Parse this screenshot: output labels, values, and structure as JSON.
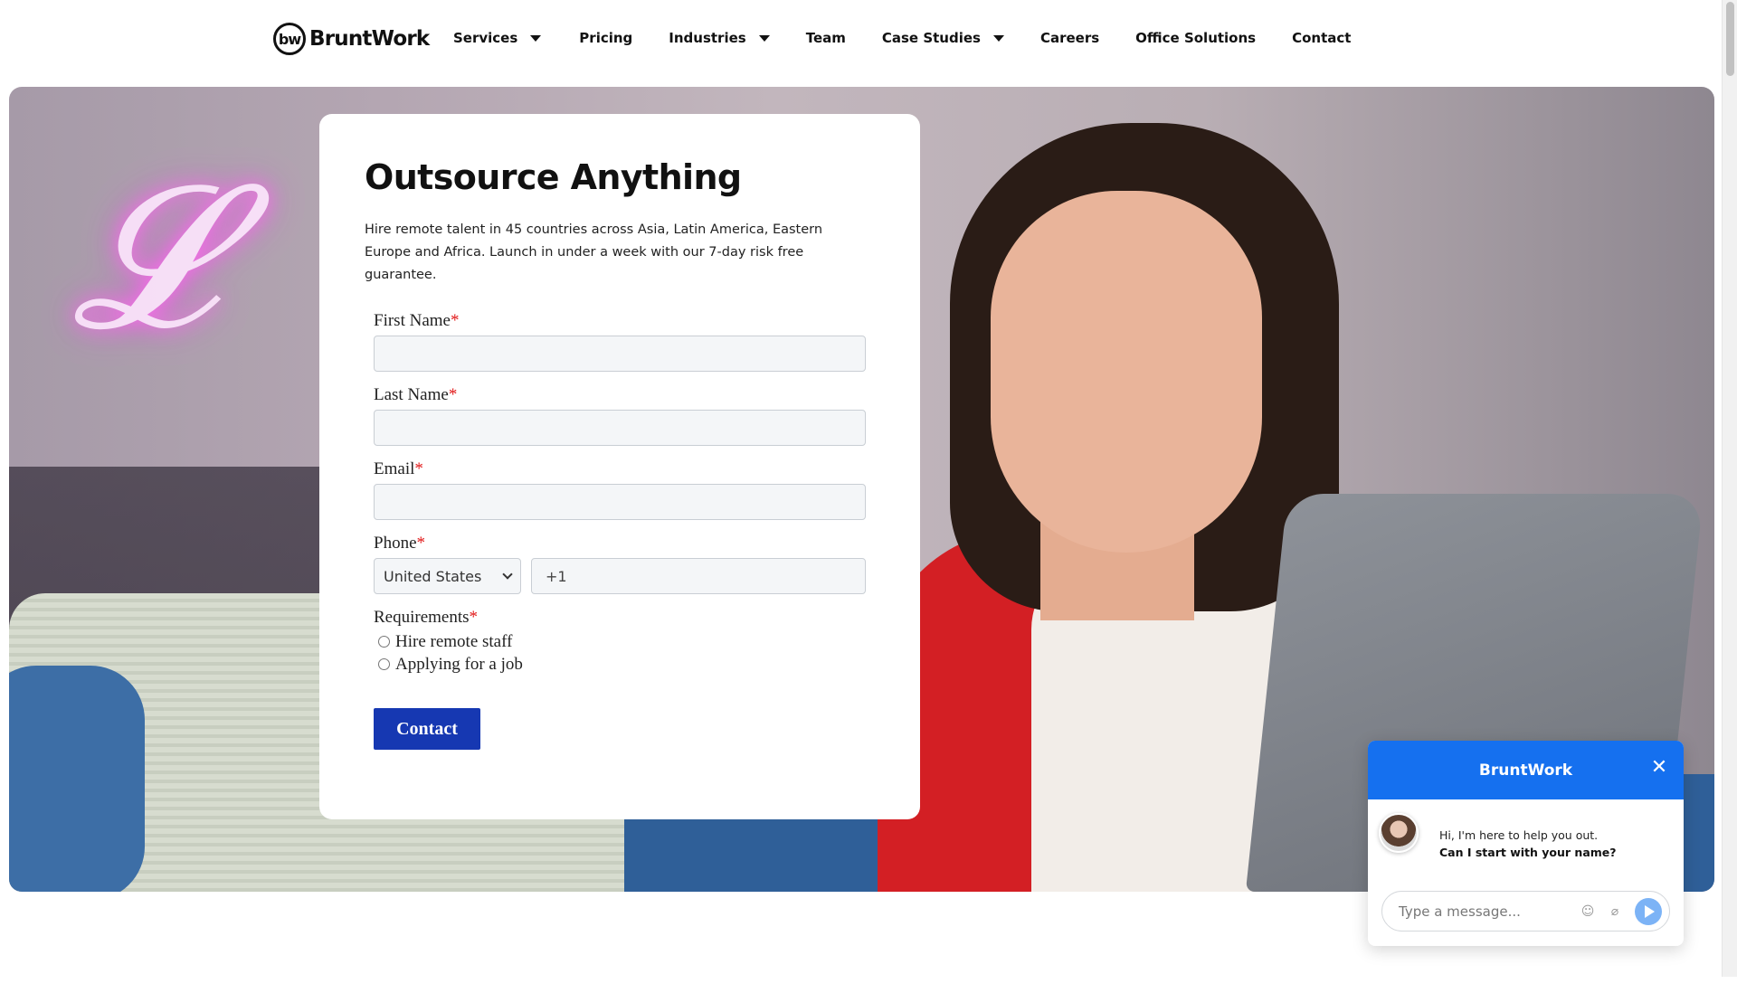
{
  "brand": {
    "logo_mark": "bw",
    "name": "BruntWork"
  },
  "nav": {
    "items": [
      {
        "label": "Services",
        "has_dropdown": true
      },
      {
        "label": "Pricing",
        "has_dropdown": false
      },
      {
        "label": "Industries",
        "has_dropdown": true
      },
      {
        "label": "Team",
        "has_dropdown": false
      },
      {
        "label": "Case Studies",
        "has_dropdown": true
      },
      {
        "label": "Careers",
        "has_dropdown": false
      },
      {
        "label": "Office Solutions",
        "has_dropdown": false
      },
      {
        "label": "Contact",
        "has_dropdown": false
      }
    ]
  },
  "hero": {
    "title": "Outsource Anything",
    "description": "Hire remote talent in 45 countries across Asia, Latin America, Eastern Europe and Africa. Launch in under a week with our 7-day risk free guarantee."
  },
  "form": {
    "first_name_label": "First Name",
    "last_name_label": "Last Name",
    "email_label": "Email",
    "phone_label": "Phone",
    "requirements_label": "Requirements",
    "required_mark": "*",
    "first_name_value": "",
    "last_name_value": "",
    "email_value": "",
    "country_selected": "United States",
    "phone_value": "+1",
    "requirement_options": [
      "Hire remote staff",
      "Applying for a job"
    ],
    "submit_label": "Contact"
  },
  "chat": {
    "title": "BruntWork",
    "close_glyph": "✕",
    "message_1": "Hi, I'm here to help you out.",
    "message_2": "Can I start with your name?",
    "input_placeholder": "Type a message..."
  },
  "colors": {
    "primary_button": "#1638b2",
    "chat_header": "#1570ef",
    "required": "#e21d1d"
  }
}
